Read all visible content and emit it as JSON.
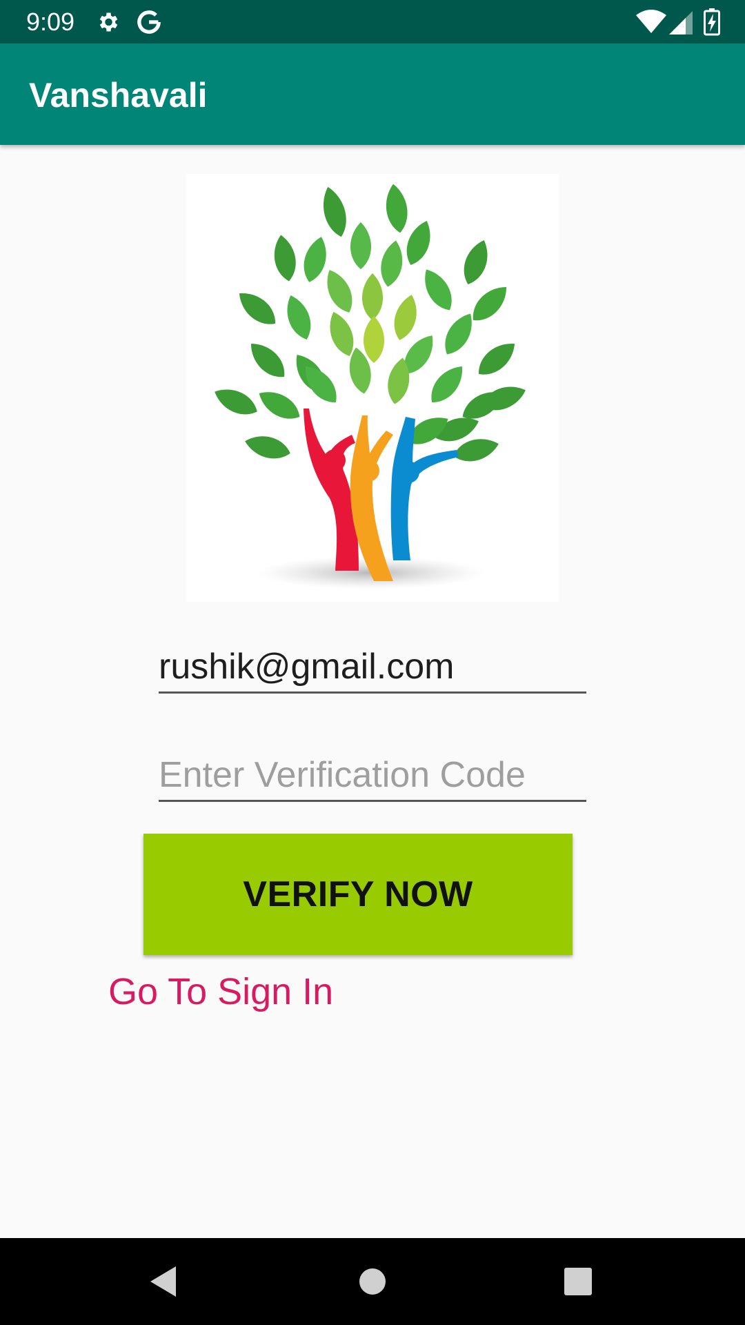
{
  "status_bar": {
    "time": "9:09",
    "icons": [
      "gear-icon",
      "google-icon",
      "wifi-icon",
      "signal-icon",
      "battery-icon"
    ]
  },
  "app_bar": {
    "title": "Vanshavali",
    "color": "#008577"
  },
  "logo": {
    "icon": "family-tree-logo"
  },
  "form": {
    "email_value": "rushik@gmail.com",
    "code_placeholder": "Enter Verification Code",
    "verify_label": "VERIFY NOW",
    "verify_color": "#99cc00",
    "sign_in_link": "Go To Sign In",
    "link_color": "#d81b60"
  },
  "nav_bar": {
    "icons": [
      "back-icon",
      "home-icon",
      "recents-icon"
    ]
  }
}
